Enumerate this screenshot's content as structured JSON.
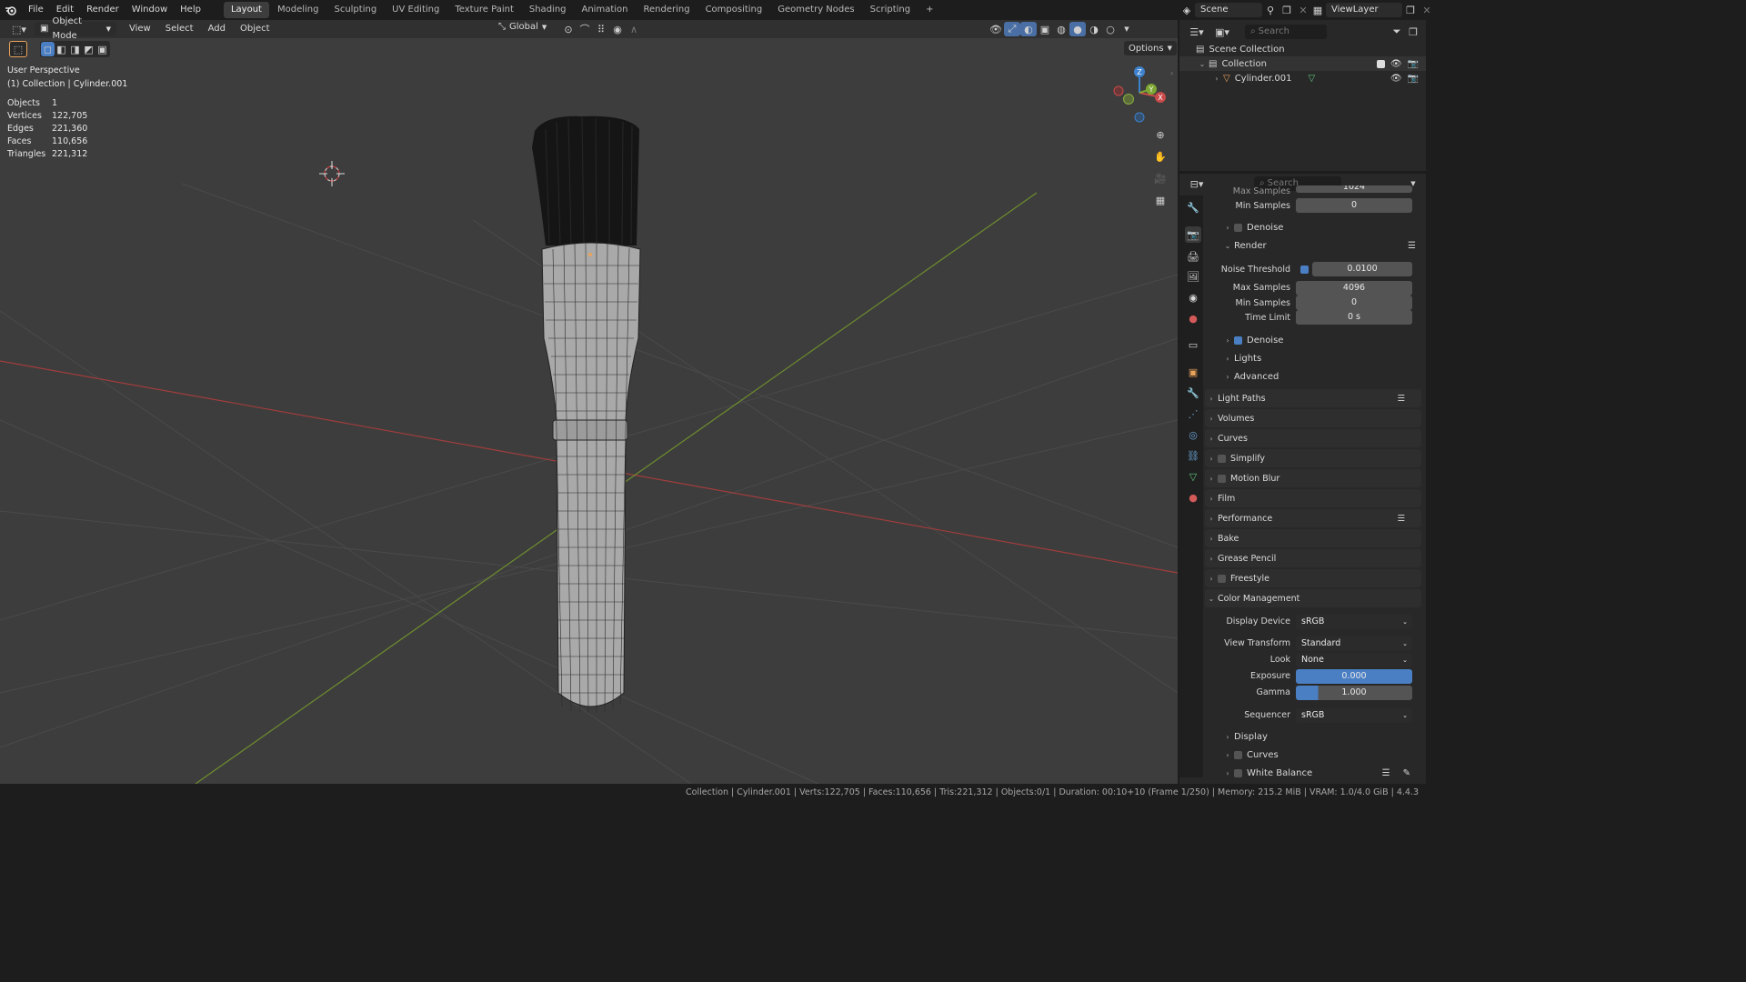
{
  "topbar": {
    "menus": [
      "File",
      "Edit",
      "Render",
      "Window",
      "Help"
    ],
    "workspaces": [
      "Layout",
      "Modeling",
      "Sculpting",
      "UV Editing",
      "Texture Paint",
      "Shading",
      "Animation",
      "Rendering",
      "Compositing",
      "Geometry Nodes",
      "Scripting"
    ],
    "active_workspace": "Layout",
    "add_tab": "+",
    "scene_name": "Scene",
    "view_layer": "ViewLayer"
  },
  "viewport_header": {
    "mode": "Object Mode",
    "menus": [
      "View",
      "Select",
      "Add",
      "Object"
    ],
    "transform_orientation": "Global",
    "options": "Options"
  },
  "viewport": {
    "view_name": "User Perspective",
    "collection_info": "(1) Collection | Cylinder.001",
    "stats": [
      {
        "label": "Objects",
        "value": "1"
      },
      {
        "label": "Vertices",
        "value": "122,705"
      },
      {
        "label": "Edges",
        "value": "221,360"
      },
      {
        "label": "Faces",
        "value": "110,656"
      },
      {
        "label": "Triangles",
        "value": "221,312"
      }
    ],
    "gizmo": {
      "x": "X",
      "y": "Y",
      "z": "Z"
    }
  },
  "outliner": {
    "search_placeholder": "Search",
    "scene_collection": "Scene Collection",
    "collection": "Collection",
    "object": "Cylinder.001"
  },
  "properties": {
    "search_placeholder": "Search",
    "cut_top_label": "Max Samples",
    "cut_top_value": "1024",
    "min_samples_top_label": "Min Samples",
    "min_samples_top_value": "0",
    "denoise_top": "Denoise",
    "render_section": "Render",
    "noise_threshold_label": "Noise Threshold",
    "noise_threshold_value": "0.0100",
    "max_samples_label": "Max Samples",
    "max_samples_value": "4096",
    "min_samples_label": "Min Samples",
    "min_samples_value": "0",
    "time_limit_label": "Time Limit",
    "time_limit_value": "0 s",
    "denoise": "Denoise",
    "lights": "Lights",
    "advanced": "Advanced",
    "panels": [
      "Light Paths",
      "Volumes",
      "Curves",
      "Simplify",
      "Motion Blur",
      "Film",
      "Performance",
      "Bake",
      "Grease Pencil",
      "Freestyle",
      "Color Management"
    ],
    "display_device_label": "Display Device",
    "display_device_value": "sRGB",
    "view_transform_label": "View Transform",
    "view_transform_value": "Standard",
    "look_label": "Look",
    "look_value": "None",
    "exposure_label": "Exposure",
    "exposure_value": "0.000",
    "gamma_label": "Gamma",
    "gamma_value": "1.000",
    "sequencer_label": "Sequencer",
    "sequencer_value": "sRGB",
    "sub_display": "Display",
    "sub_curves": "Curves",
    "sub_white_balance": "White Balance"
  },
  "statusbar": {
    "text": "Collection | Cylinder.001 | Verts:122,705 | Faces:110,656 | Tris:221,312 | Objects:0/1 | Duration: 00:10+10 (Frame 1/250) | Memory: 215.2 MiB | VRAM: 1.0/4.0 GiB | 4.4.3"
  },
  "colors": {
    "accent": "#4a7fc4",
    "x_axis": "#c94a4a",
    "y_axis": "#7da633",
    "z_axis": "#3d82cf",
    "orange_obj": "#e8a35b"
  }
}
